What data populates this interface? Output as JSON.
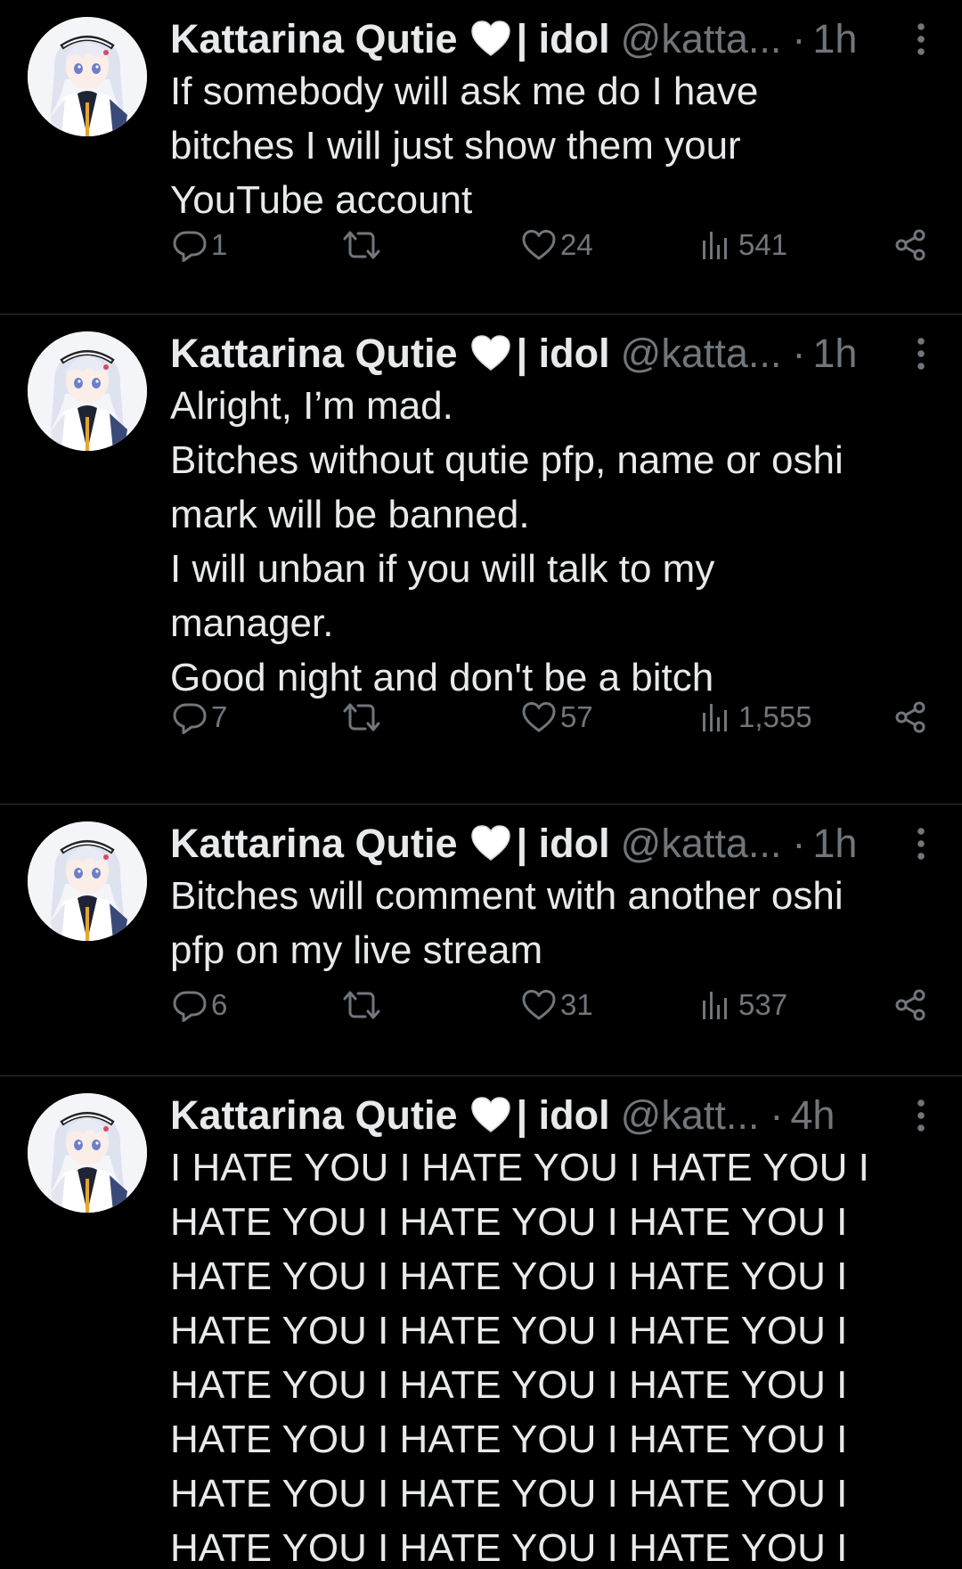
{
  "tweets": [
    {
      "name": "Kattarina Qutie",
      "name_suffix": "| idol",
      "handle": "@katta...",
      "separator": "·",
      "time": "1h",
      "text": "If somebody will ask me do I have\nbitches I will just show them your\nYouTube account",
      "replies": "1",
      "retweets": "",
      "likes": "24",
      "views": "541"
    },
    {
      "name": "Kattarina Qutie",
      "name_suffix": "| idol",
      "handle": "@katta...",
      "separator": "·",
      "time": "1h",
      "text": "Alright, I’m mad.\nBitches without qutie pfp, name or oshi\nmark will be banned.\nI will unban if you will talk to my\nmanager.\nGood night and don't be a bitch",
      "replies": "7",
      "retweets": "",
      "likes": "57",
      "views": "1,555"
    },
    {
      "name": "Kattarina Qutie",
      "name_suffix": "| idol",
      "handle": "@katta...",
      "separator": "·",
      "time": "1h",
      "text": "Bitches will comment with another oshi\npfp on my live stream",
      "replies": "6",
      "retweets": "",
      "likes": "31",
      "views": "537"
    },
    {
      "name": "Kattarina Qutie",
      "name_suffix": "| idol",
      "handle": "@katt...",
      "separator": "·",
      "time": "4h",
      "text": "I HATE YOU I HATE YOU I HATE YOU I\nHATE YOU I HATE YOU I HATE YOU I\nHATE YOU I HATE YOU I HATE YOU I\nHATE YOU I HATE YOU I HATE YOU I\nHATE YOU I HATE YOU I HATE YOU I\nHATE YOU I HATE YOU I HATE YOU I\nHATE YOU I HATE YOU I HATE YOU I\nHATE YOU I HATE YOU I HATE YOU I"
    }
  ],
  "colors": {
    "background": "#000000",
    "text_primary": "#e7e9ea",
    "text_secondary": "#71767b",
    "divider": "#2f3336"
  },
  "icons": {
    "verified_emoji": "white-heart-emoji",
    "menu": "more-vertical-icon",
    "reply": "reply-bubble-icon",
    "retweet": "retweet-icon",
    "like": "heart-icon",
    "views": "views-bar-chart-icon",
    "share": "share-icon"
  }
}
